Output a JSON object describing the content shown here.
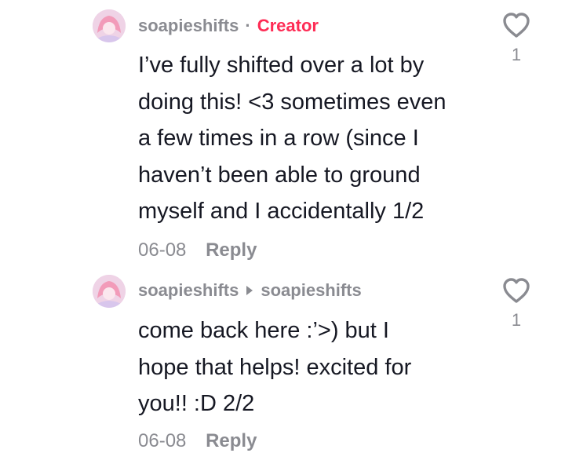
{
  "comments": [
    {
      "username": "soapieshifts",
      "separator": "·",
      "badge": "Creator",
      "text": "I’ve fully shifted over a lot by\ndoing this! <3 sometimes even\na few times in a row (since I\nhaven’t been able to ground\nmyself and I accidentally 1/2",
      "date": "06-08",
      "reply_label": "Reply",
      "likes": "1",
      "like_icon": "heart-outline-icon"
    },
    {
      "username": "soapieshifts",
      "reply_to": "soapieshifts",
      "text": "come back here :’>) but I\nhope that helps! excited for\nyou!! :D 2/2",
      "date": "06-08",
      "reply_label": "Reply",
      "likes": "1",
      "like_icon": "heart-outline-icon"
    }
  ],
  "colors": {
    "accent": "#fe2c55",
    "muted": "#8a8b91",
    "text": "#161823"
  }
}
